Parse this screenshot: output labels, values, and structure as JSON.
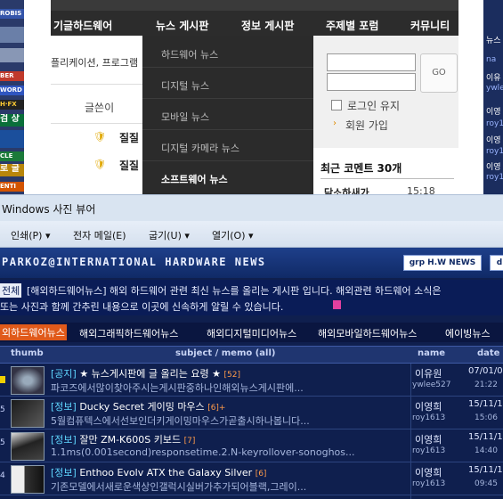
{
  "website": {
    "left_banner": [
      "ROBIS",
      "",
      "",
      "BER",
      "WORD",
      "H·FX",
      "검 상",
      "",
      "",
      "CLE",
      "로 굴",
      "ENTI"
    ],
    "nav": [
      "기글하드웨어",
      "뉴스 게시판",
      "정보 게시판",
      "주제별 포럼",
      "커뮤니티"
    ],
    "submenu": [
      "하드웨어 뉴스",
      "디지털 뉴스",
      "모바일 뉴스",
      "디지털 카메라 뉴스",
      "소프트웨어 뉴스"
    ],
    "left_text": "플리케이션, 프로그램",
    "author_header": "글쓴이",
    "authors": [
      "질질",
      "질질"
    ],
    "login": {
      "go_label": "GO",
      "keep_login": "로그인 유지",
      "signup": "회원 가입"
    },
    "recent_comments_title": "최근 코멘트 30개",
    "recent_item": "닦소하새가",
    "recent_time": "15:18",
    "right_banner": [
      "뉴스",
      "na",
      "이유",
      "ywle",
      "이영",
      "roy1",
      "이영",
      "roy1",
      "이영",
      "roy1",
      "이영",
      "roy1"
    ]
  },
  "viewer": {
    "title": "Windows 사진 뷰어",
    "menu": [
      "인쇄(P) ▾",
      "전자 메일(E)",
      "굽기(U) ▾",
      "열기(O) ▾"
    ]
  },
  "board": {
    "site_title": "PARKOZ@INTERNATIONAL HARDWARE NEWS",
    "btn_grp": "grp H.W NEWS",
    "btn_d": "d",
    "desc_prefix": "전체",
    "desc_line1": "[해외하드웨어뉴스] 해외 하드웨어 관련 최신 뉴스를 올리는 게시판 입니다. 해외관련 하드웨어 소식은",
    "desc_line2": "또는 사진과 함께 간추린 내용으로 이곳에 신속하게 알릴 수 있습니다.",
    "tags": [
      "외하드웨어뉴스",
      "해외그래픽하드웨어뉴스",
      "해외디지털미디어뉴스",
      "해외모바일하드웨어뉴스",
      "에이빙뉴스"
    ],
    "col_thumb": "thumb",
    "col_subject": "subject / memo (all)",
    "col_name": "name",
    "col_date": "date",
    "rows": [
      {
        "num": "",
        "category": "[공지]",
        "title": "★ 뉴스게시판에 글 올리는 요령 ★",
        "count": "[52]",
        "memo": "파코즈에서많이찾아주시는게시판중하나인해외뉴스게시판에...",
        "name": "이유원",
        "id": "ywlee527",
        "date": "07/01/0",
        "time": "21:22"
      },
      {
        "num": "5",
        "category": "[정보]",
        "title": "Ducky Secret 게이밍 마우스",
        "count": "[6]+",
        "memo": "5월컴퓨텍스에서선보인더키게이밍마우스가곧출시하나봅니다...",
        "name": "이영희",
        "id": "roy1613",
        "date": "15/11/1",
        "time": "15:06"
      },
      {
        "num": "5",
        "category": "[정보]",
        "title": "잘만 ZM-K600S 키보드",
        "count": "[7]",
        "memo": "1.1ms(0.001second)responsetime.2.N-keyrollover-sonoghos...",
        "name": "이영희",
        "id": "roy1613",
        "date": "15/11/1",
        "time": "14:40"
      },
      {
        "num": "4",
        "category": "[정보]",
        "title": "Enthoo Evolv ATX the Galaxy Silver",
        "count": "[6]",
        "memo": "기존모델에서새로운색상인갤럭시실버가추가되어블랙,그레이...",
        "name": "이영희",
        "id": "roy1613",
        "date": "15/11/1",
        "time": "09:45"
      }
    ]
  }
}
